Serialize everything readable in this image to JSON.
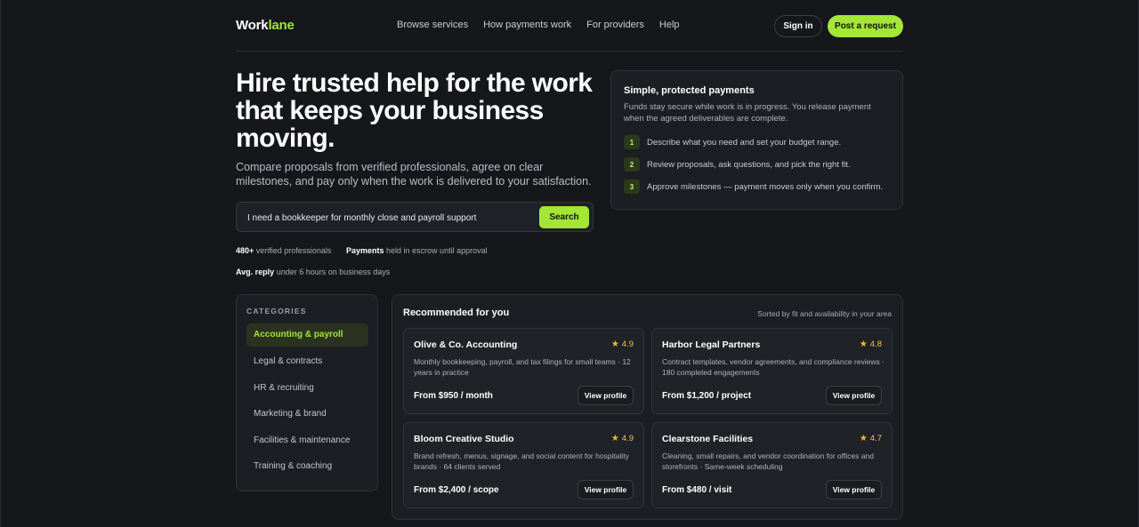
{
  "brand": {
    "name_main": "Work",
    "name_accent": "lane",
    "accent_color": "#a3e635"
  },
  "nav": {
    "items": [
      "Browse services",
      "How payments work",
      "For providers",
      "Help"
    ],
    "sign_in": "Sign in",
    "post_request": "Post a request"
  },
  "hero": {
    "title": "Hire trusted help for the work that keeps your business moving.",
    "subtitle": "Compare proposals from verified professionals, agree on clear milestones, and pay only when the work is delivered to your satisfaction.",
    "search_value": "I need a bookkeeper for monthly close and payroll support",
    "search_button": "Search"
  },
  "stats": [
    {
      "strong": "480+",
      "text": " verified professionals"
    },
    {
      "strong": "Payments",
      "text": " held in escrow until approval"
    },
    {
      "strong": "Avg. reply",
      "text": " under 6 hours on business days"
    }
  ],
  "payments": {
    "title": "Simple, protected payments",
    "description": "Funds stay secure while work is in progress. You release payment when the agreed deliverables are complete.",
    "steps": [
      {
        "num": "1",
        "text": "Describe what you need and set your budget range."
      },
      {
        "num": "2",
        "text": "Review proposals, ask questions, and pick the right fit."
      },
      {
        "num": "3",
        "text": "Approve milestones — payment moves only when you confirm."
      }
    ]
  },
  "categories": {
    "heading": "CATEGORIES",
    "items": [
      "Accounting & payroll",
      "Legal & contracts",
      "HR & recruiting",
      "Marketing & brand",
      "Facilities & maintenance",
      "Training & coaching"
    ],
    "active_index": 0
  },
  "recommended": {
    "title": "Recommended for you",
    "sort_text": "Sorted by fit and availability in your area",
    "cards": [
      {
        "name": "Olive & Co. Accounting",
        "rating": "4.9",
        "description": "Monthly bookkeeping, payroll, and tax filings for small teams · 12 years in practice",
        "price": "From $950 / month",
        "button": "View profile"
      },
      {
        "name": "Harbor Legal Partners",
        "rating": "4.8",
        "description": "Contract templates, vendor agreements, and compliance reviews · 180 completed engagements",
        "price": "From $1,200 / project",
        "button": "View profile"
      },
      {
        "name": "Bloom Creative Studio",
        "rating": "4.9",
        "description": "Brand refresh, menus, signage, and social content for hospitality brands · 64 clients served",
        "price": "From $2,400 / scope",
        "button": "View profile"
      },
      {
        "name": "Clearstone Facilities",
        "rating": "4.7",
        "description": "Cleaning, small repairs, and vendor coordination for offices and storefronts · Same-week scheduling",
        "price": "From $480 / visit",
        "button": "View profile"
      }
    ]
  }
}
